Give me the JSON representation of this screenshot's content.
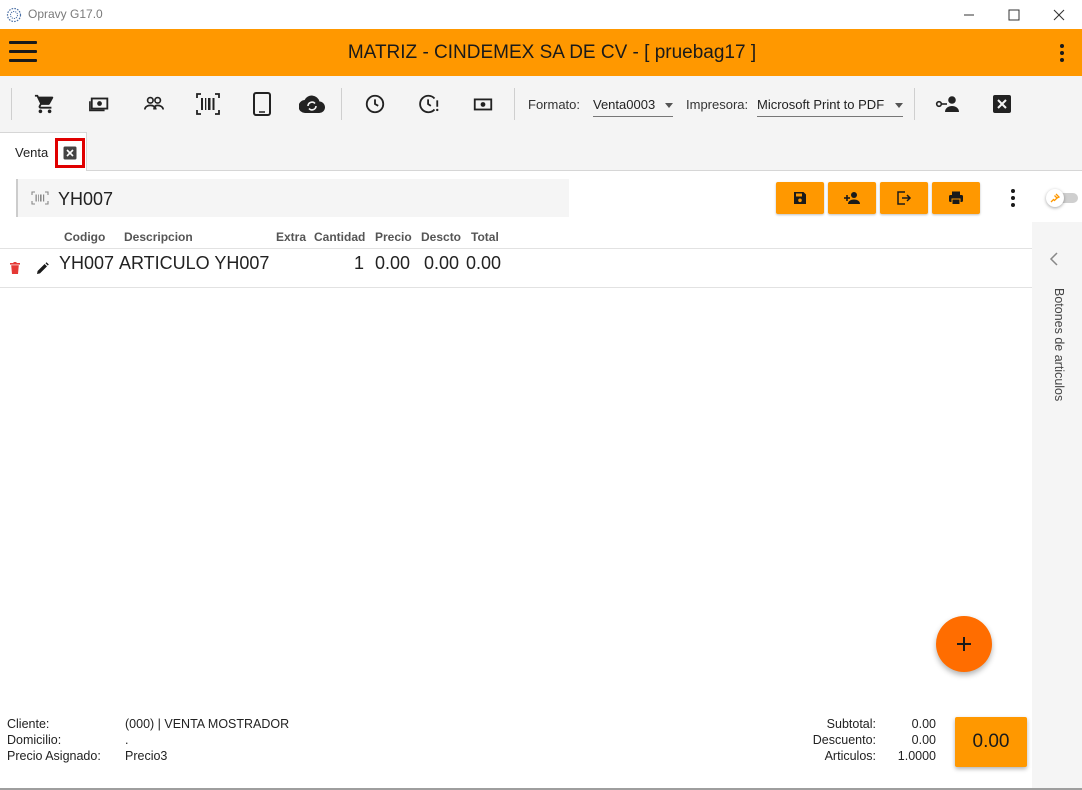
{
  "window": {
    "title": "Opravy G17.0"
  },
  "header": {
    "title": "MATRIZ - CINDEMEX SA DE CV - [ pruebag17 ]"
  },
  "toolbar": {
    "formato_label": "Formato:",
    "formato_value": "Venta0003",
    "impresora_label": "Impresora:",
    "impresora_value": "Microsoft Print to PDF"
  },
  "tabs": [
    {
      "label": "Venta"
    }
  ],
  "scan": {
    "value": "YH007"
  },
  "table": {
    "headers": {
      "codigo": "Codigo",
      "descripcion": "Descripcion",
      "extra": "Extra",
      "cantidad": "Cantidad",
      "precio": "Precio",
      "descto": "Descto",
      "total": "Total"
    },
    "rows": [
      {
        "codigo": "YH007",
        "descripcion": "ARTICULO  YH007",
        "extra": "",
        "cantidad": "1",
        "precio": "0.00",
        "descto": "0.00",
        "total": "0.00"
      }
    ]
  },
  "side_panel": {
    "label": "Botones de articulos"
  },
  "footer": {
    "cliente_label": "Cliente:",
    "cliente_value": "(000) | VENTA MOSTRADOR",
    "domicilio_label": "Domicilio:",
    "domicilio_value": ".",
    "precio_label": "Precio Asignado:",
    "precio_value": "Precio3",
    "subtotal_label": "Subtotal:",
    "subtotal_value": "0.00",
    "descuento_label": "Descuento:",
    "descuento_value": "0.00",
    "articulos_label": "Articulos:",
    "articulos_value": "1.0000",
    "total": "0.00"
  },
  "colors": {
    "accent": "#ff9800",
    "fab": "#ff6d00",
    "highlight": "#e00000"
  }
}
